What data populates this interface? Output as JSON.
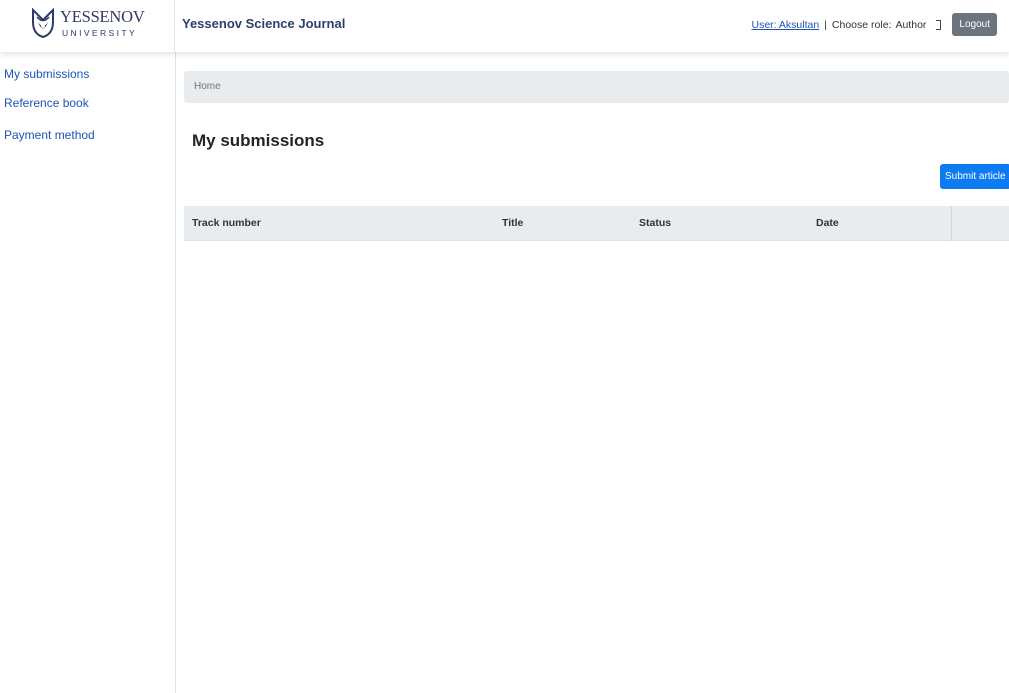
{
  "logo": {
    "name": "YESSENOV",
    "subtitle": "UNIVERSITY"
  },
  "header": {
    "brand": "Yessenov Science Journal",
    "user_link": "User: Aksultan",
    "separator": "|",
    "choose_role_label": "Choose role:",
    "role_value": "Author",
    "logout": "Logout"
  },
  "sidebar": {
    "items": [
      {
        "label": "My submissions"
      },
      {
        "label": "Reference book"
      },
      {
        "label": "Payment method"
      }
    ]
  },
  "main": {
    "breadcrumb": "Home",
    "title": "My submissions",
    "submit_button": "Submit article",
    "table": {
      "columns": [
        "Track number",
        "Title",
        "Status",
        "Date",
        ""
      ],
      "rows": []
    }
  },
  "colors": {
    "brand_text": "#2e3f6e",
    "link": "#1e55b3",
    "primary_button": "#0d7bf2",
    "secondary_button": "#6c757d",
    "header_band": "#e9ecef"
  }
}
